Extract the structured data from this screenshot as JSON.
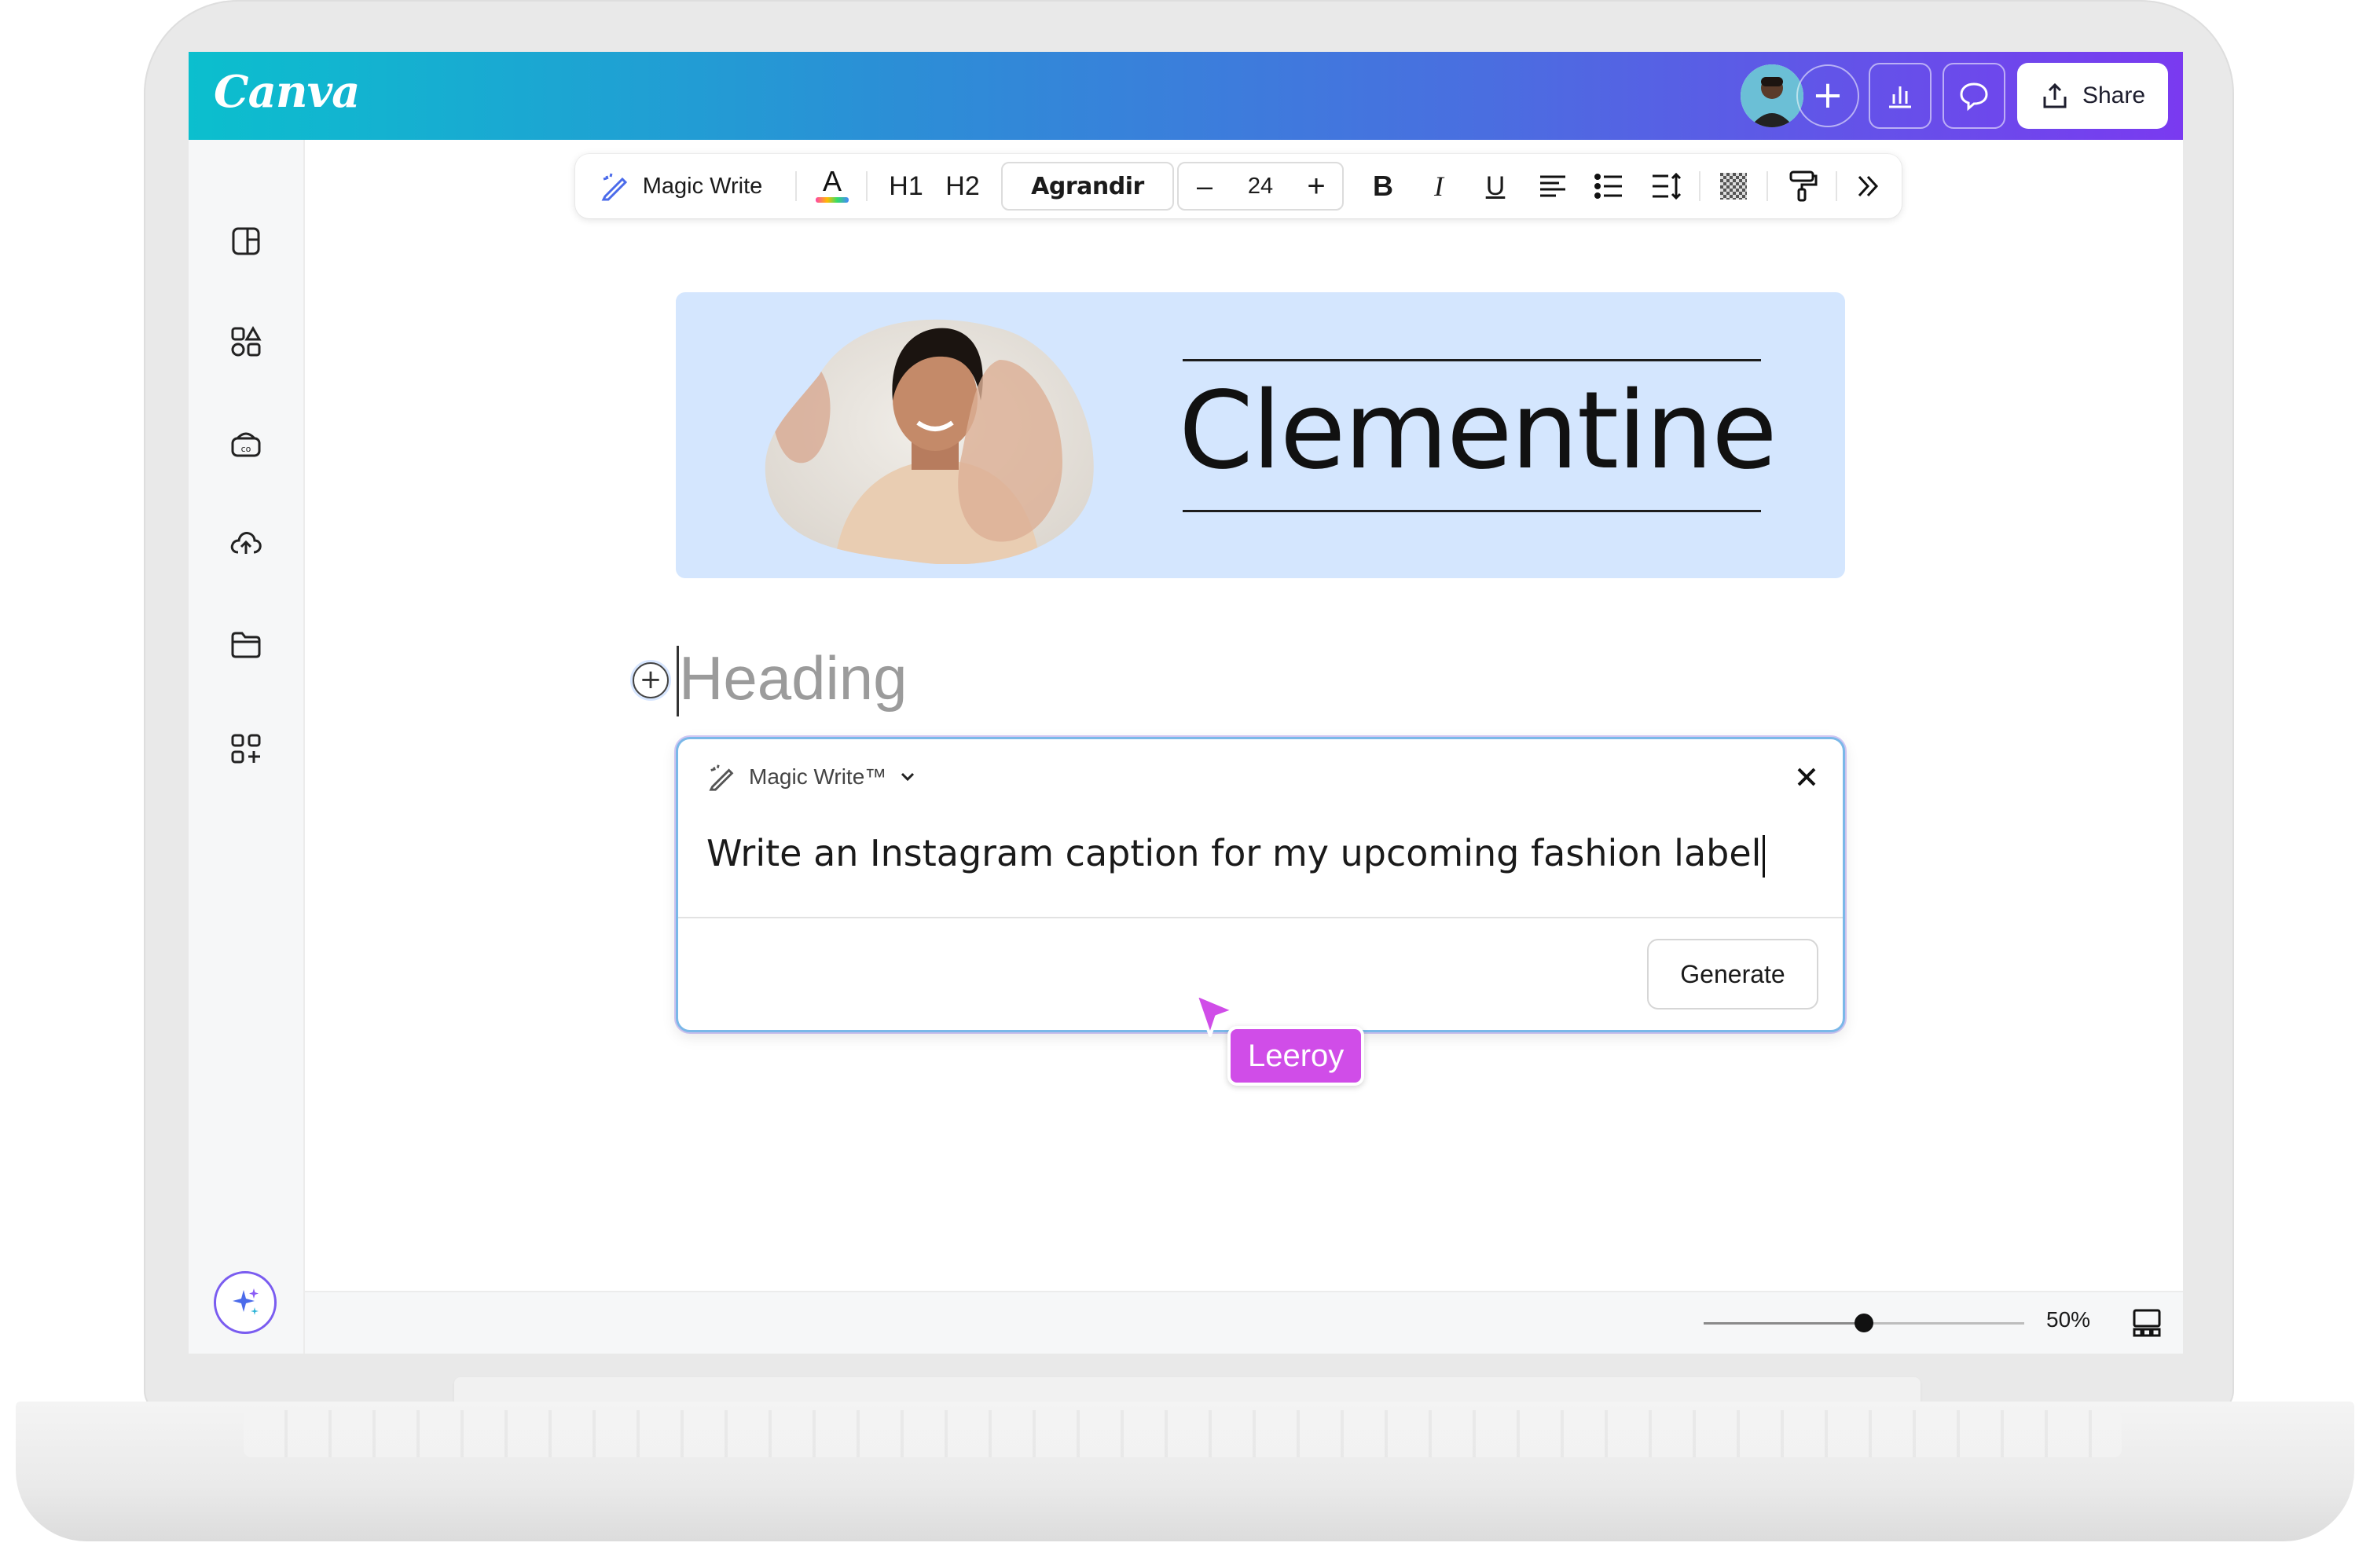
{
  "app": {
    "logo": "Canva"
  },
  "header": {
    "share_label": "Share",
    "icons": [
      "add-collaborator-icon",
      "insights-icon",
      "comment-icon",
      "upload-share-icon"
    ]
  },
  "sidebar": {
    "icons": [
      "design-icon",
      "elements-icon",
      "brand-icon",
      "uploads-icon",
      "projects-icon",
      "apps-icon",
      "magic-icon"
    ]
  },
  "toolbar": {
    "magic_write_label": "Magic Write",
    "h1": "H1",
    "h2": "H2",
    "font": "Agrandir",
    "size_minus": "–",
    "font_size": "24",
    "size_plus": "+",
    "bold": "B",
    "italic": "I",
    "underline": "U"
  },
  "hero": {
    "title": "Clementine"
  },
  "editor": {
    "heading_placeholder": "Heading"
  },
  "magic_write": {
    "title": "Magic Write™",
    "prompt": "Write an Instagram caption for my upcoming fashion label",
    "generate_label": "Generate"
  },
  "collaborator": {
    "name": "Leeroy",
    "color": "#d04de8"
  },
  "zoom": {
    "label": "50%",
    "level": 0.5
  },
  "colors": {
    "accent_start": "#0bbfce",
    "accent_end": "#7a3af0",
    "hero_bg": "#d4e6fe"
  }
}
